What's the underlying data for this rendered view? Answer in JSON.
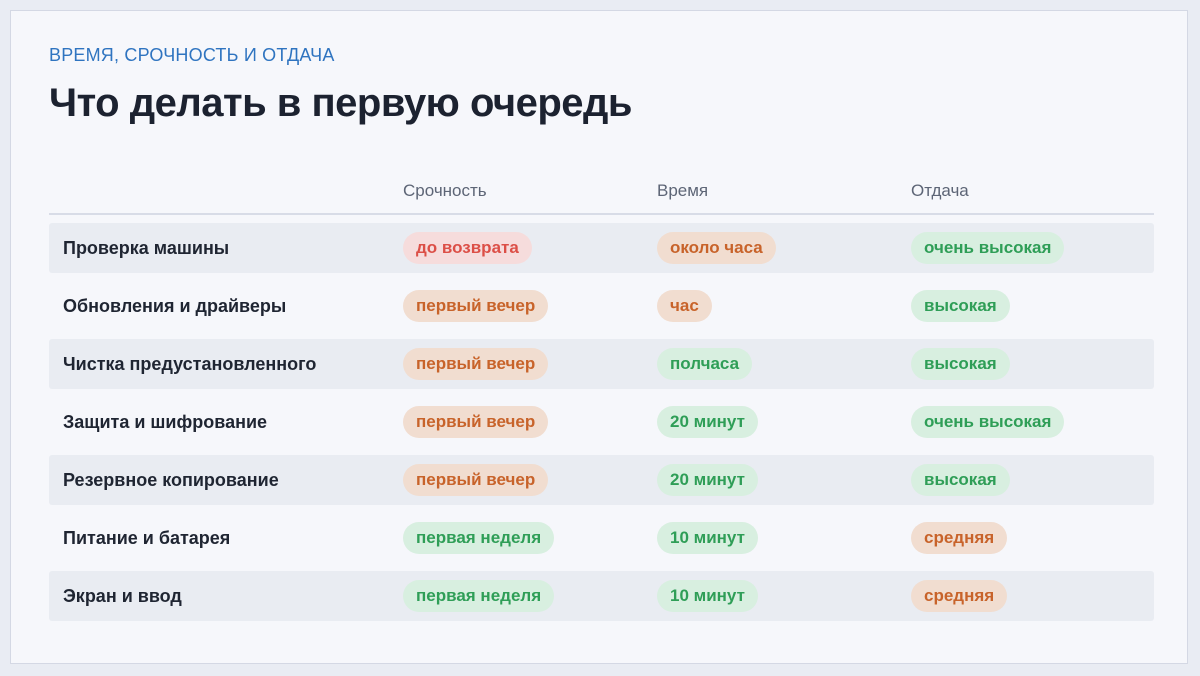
{
  "header": {
    "eyebrow": "ВРЕМЯ, СРОЧНОСТЬ И ОТДАЧА",
    "title": "Что делать в первую очередь"
  },
  "table": {
    "columns": [
      "Срочность",
      "Время",
      "Отдача"
    ],
    "rows": [
      {
        "label": "Проверка машины",
        "urgency": "до возврата",
        "urgency_tone": "red",
        "time": "около часа",
        "time_tone": "orange",
        "payoff": "очень высокая",
        "payoff_tone": "green"
      },
      {
        "label": "Обновления и драйверы",
        "urgency": "первый вечер",
        "urgency_tone": "orange",
        "time": "час",
        "time_tone": "orange",
        "payoff": "высокая",
        "payoff_tone": "green"
      },
      {
        "label": "Чистка предустановленного",
        "urgency": "первый вечер",
        "urgency_tone": "orange",
        "time": "полчаса",
        "time_tone": "green",
        "payoff": "высокая",
        "payoff_tone": "green"
      },
      {
        "label": "Защита и шифрование",
        "urgency": "первый вечер",
        "urgency_tone": "orange",
        "time": "20 минут",
        "time_tone": "green",
        "payoff": "очень высокая",
        "payoff_tone": "green"
      },
      {
        "label": "Резервное копирование",
        "urgency": "первый вечер",
        "urgency_tone": "orange",
        "time": "20 минут",
        "time_tone": "green",
        "payoff": "высокая",
        "payoff_tone": "green"
      },
      {
        "label": "Питание и батарея",
        "urgency": "первая неделя",
        "urgency_tone": "green",
        "time": "10 минут",
        "time_tone": "green",
        "payoff": "средняя",
        "payoff_tone": "orange"
      },
      {
        "label": "Экран и ввод",
        "urgency": "первая неделя",
        "urgency_tone": "green",
        "time": "10 минут",
        "time_tone": "green",
        "payoff": "средняя",
        "payoff_tone": "orange"
      }
    ]
  },
  "colors": {
    "accent": "#2f74c0",
    "red": "#dc4f47",
    "orange": "#c8632a",
    "green": "#2f9e57"
  }
}
